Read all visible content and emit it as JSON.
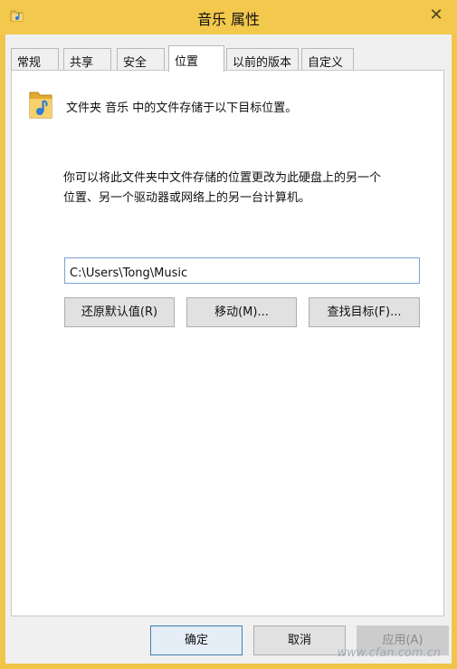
{
  "window": {
    "title": "音乐 属性",
    "close_glyph": "✕"
  },
  "tabs": [
    {
      "label": "常规"
    },
    {
      "label": "共享"
    },
    {
      "label": "安全"
    },
    {
      "label": "位置",
      "active": true
    },
    {
      "label": "以前的版本"
    },
    {
      "label": "自定义"
    }
  ],
  "location": {
    "heading": "文件夹 音乐 中的文件存储于以下目标位置。",
    "description_line1": "你可以将此文件夹中文件存储的位置更改为此硬盘上的另一个",
    "description_line2": "位置、另一个驱动器或网络上的另一台计算机。",
    "path_value": "C:\\Users\\Tong\\Music",
    "restore_default_label": "还原默认值(R)",
    "move_label": "移动(M)...",
    "find_target_label": "查找目标(F)..."
  },
  "footer": {
    "ok_label": "确定",
    "cancel_label": "取消",
    "apply_label": "应用(A)"
  },
  "watermark": "www.cfan.com.cn",
  "colors": {
    "title_bar": "#f2c84d",
    "accent_border": "#7aa3d6",
    "primary_button_border": "#3c7fb1"
  },
  "icons": {
    "title": "music-folder-icon",
    "folder": "music-folder-icon",
    "close": "close-icon"
  }
}
